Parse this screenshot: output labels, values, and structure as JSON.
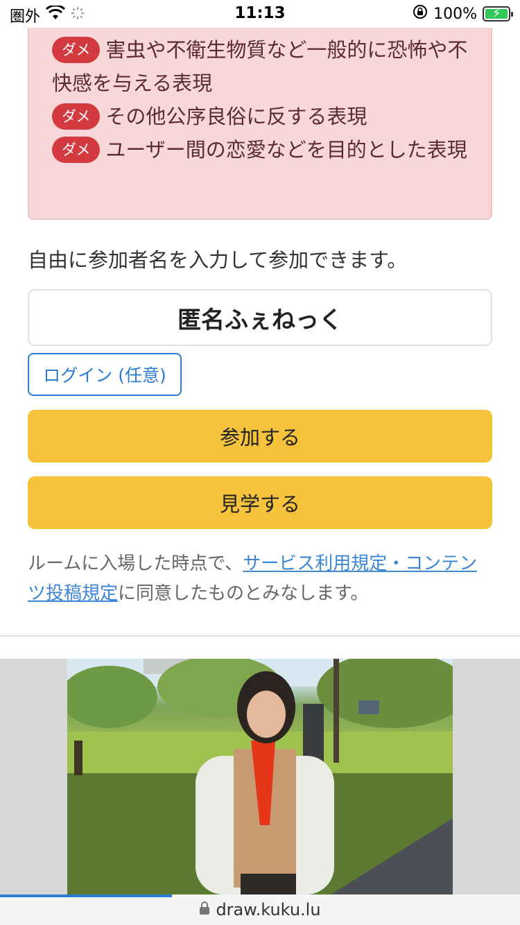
{
  "status_bar": {
    "carrier": "圏外",
    "time": "11:13",
    "battery": "100%",
    "battery_level": 1.0
  },
  "rules": {
    "badge_label": "ダメ",
    "items": [
      "害虫や不衛生物質など一般的に恐怖や不快感を与える表現",
      "その他公序良俗に反する表現",
      "ユーザー間の恋愛などを目的とした表現"
    ]
  },
  "join_form": {
    "info": "自由に参加者名を入力して参加できます。",
    "name_value": "匿名ふぇねっく",
    "login_label": "ログイン (任意)",
    "join_label": "参加する",
    "watch_label": "見学する"
  },
  "terms": {
    "prefix": "ルームに入場した時点で、",
    "link": "サービス利用規定・コンテンツ投稿規定",
    "suffix": "に同意したものとみなします。"
  },
  "browser": {
    "url": "draw.kuku.lu",
    "load_progress": 0.33
  },
  "colors": {
    "danger": "#d33a3f",
    "warning_bg": "#f8d7da",
    "button_yellow": "#f5c33b",
    "link_blue": "#2a7bd2"
  }
}
